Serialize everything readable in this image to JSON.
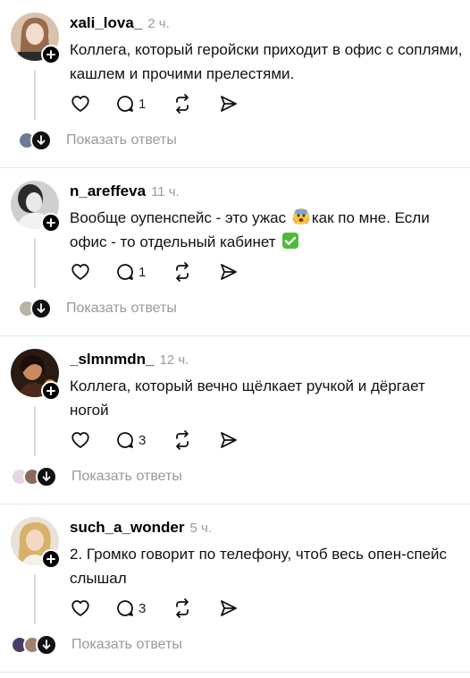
{
  "colors": {
    "divider": "#e6e6e6",
    "muted": "#9a9a9a",
    "check_green": "#4cbb3a"
  },
  "posts": [
    {
      "username": "xali_lova_",
      "time": "2 ч.",
      "text": "Коллега, который геройски приходит в офис с соплями, кашлем и прочими прелестями.",
      "reply_count": "1",
      "show_replies": "Показать ответы"
    },
    {
      "username": "n_areffeva",
      "time": "11 ч.",
      "text_part1": "Вообще оупенспейс - это ужас ",
      "text_emoji1": "fearful-face-emoji",
      "text_part2": "как по мне. Если офис - то отдельный кабинет ",
      "text_emoji2": "check-mark-emoji",
      "reply_count": "1",
      "show_replies": "Показать ответы"
    },
    {
      "username": "_slmnmdn_",
      "time": "12 ч.",
      "text": "Коллега, который вечно щёлкает ручкой и дёргает ногой",
      "reply_count": "3",
      "show_replies": "Показать ответы"
    },
    {
      "username": "such_a_wonder",
      "time": "5 ч.",
      "text": "2. Громко говорит по телефону, чтоб весь опен-спейс слышал",
      "reply_count": "3",
      "show_replies": "Показать ответы"
    }
  ]
}
